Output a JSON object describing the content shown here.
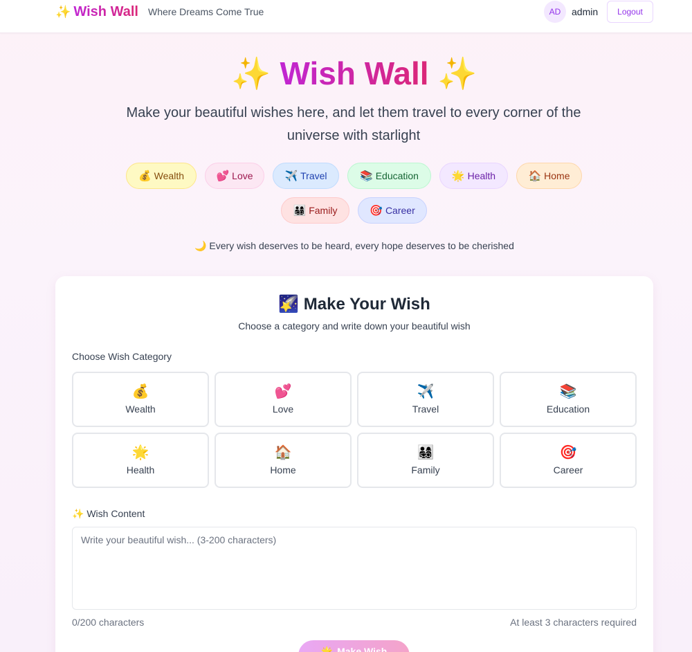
{
  "header": {
    "brand_icon": "✨",
    "brand": "Wish Wall",
    "tagline": "Where Dreams Come True",
    "avatar": "AD",
    "username": "admin",
    "logout": "Logout"
  },
  "hero": {
    "spark_left": "✨",
    "title": "Wish Wall",
    "spark_right": "✨",
    "subtitle": "Make your beautiful wishes here, and let them travel to every corner of the universe with starlight",
    "motto": "🌙 Every wish deserves to be heard, every hope deserves to be cherished",
    "chips": [
      {
        "icon": "💰",
        "label": "Wealth",
        "bg": "#fef9c3",
        "border": "#fde68a",
        "color": "#854d0e"
      },
      {
        "icon": "💕",
        "label": "Love",
        "bg": "#fce7f3",
        "border": "#fbcfe8",
        "color": "#9d174d"
      },
      {
        "icon": "✈️",
        "label": "Travel",
        "bg": "#dbeafe",
        "border": "#bfdbfe",
        "color": "#1e40af"
      },
      {
        "icon": "📚",
        "label": "Education",
        "bg": "#dcfce7",
        "border": "#bbf7d0",
        "color": "#166534"
      },
      {
        "icon": "🌟",
        "label": "Health",
        "bg": "#f3e8ff",
        "border": "#e9d5ff",
        "color": "#6b21a8"
      },
      {
        "icon": "🏠",
        "label": "Home",
        "bg": "#ffedd5",
        "border": "#fed7aa",
        "color": "#9a3412"
      },
      {
        "icon": "👨‍👩‍👧‍👦",
        "label": "Family",
        "bg": "#fee2e2",
        "border": "#fecaca",
        "color": "#991b1b"
      },
      {
        "icon": "🎯",
        "label": "Career",
        "bg": "#e0e7ff",
        "border": "#c7d2fe",
        "color": "#3730a3"
      }
    ]
  },
  "form": {
    "title": "🌠 Make Your Wish",
    "subtitle": "Choose a category and write down your beautiful wish",
    "category_label": "Choose Wish Category",
    "categories": [
      {
        "icon": "💰",
        "label": "Wealth"
      },
      {
        "icon": "💕",
        "label": "Love"
      },
      {
        "icon": "✈️",
        "label": "Travel"
      },
      {
        "icon": "📚",
        "label": "Education"
      },
      {
        "icon": "🌟",
        "label": "Health"
      },
      {
        "icon": "🏠",
        "label": "Home"
      },
      {
        "icon": "👨‍👩‍👧‍👦",
        "label": "Family"
      },
      {
        "icon": "🎯",
        "label": "Career"
      }
    ],
    "content_label": "✨ Wish Content",
    "placeholder": "Write your beautiful wish... (3-200 characters)",
    "value": "",
    "counter": "0/200 characters",
    "requirement": "At least 3 characters required",
    "submit_icon": "🌟",
    "submit": "Make Wish"
  }
}
